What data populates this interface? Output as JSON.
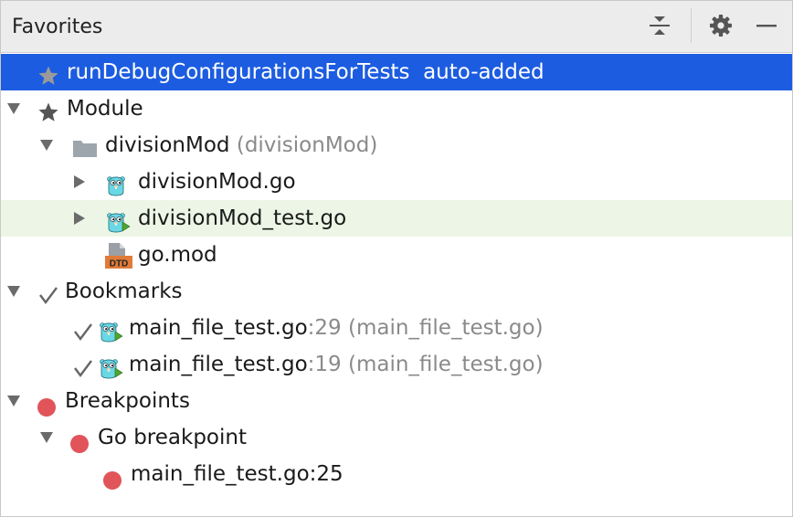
{
  "panel": {
    "title": "Favorites",
    "actions": [
      "collapse-all-icon",
      "gear-icon",
      "minimize-icon"
    ]
  },
  "tree": {
    "run_config": {
      "name": "runDebugConfigurationsForTests",
      "suffix": "auto-added"
    },
    "module": {
      "label": "Module",
      "folder": {
        "name": "divisionMod",
        "detail": "(divisionMod)"
      },
      "files": [
        {
          "name": "divisionMod.go"
        },
        {
          "name": "divisionMod_test.go"
        },
        {
          "name": "go.mod",
          "badge": "DTD"
        }
      ]
    },
    "bookmarks": {
      "label": "Bookmarks",
      "items": [
        {
          "file": "main_file_test.go",
          "line": ":29",
          "detail": "(main_file_test.go)"
        },
        {
          "file": "main_file_test.go",
          "line": ":19",
          "detail": "(main_file_test.go)"
        }
      ]
    },
    "breakpoints": {
      "label": "Breakpoints",
      "group": "Go breakpoint",
      "item": "main_file_test.go:25"
    }
  },
  "colors": {
    "selection": "#1c5ce0",
    "hover": "#edf6e6",
    "breakpoint": "#e0545a",
    "gopher": "#6ad7e5"
  }
}
